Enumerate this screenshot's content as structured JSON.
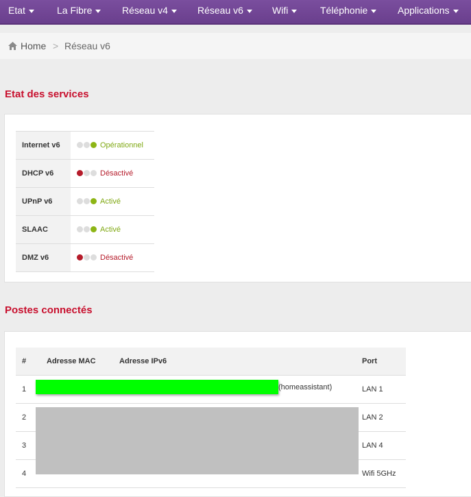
{
  "nav": {
    "items": [
      {
        "label": "Etat"
      },
      {
        "label": "La Fibre"
      },
      {
        "label": "Réseau v4"
      },
      {
        "label": "Réseau v6"
      },
      {
        "label": "Wifi"
      },
      {
        "label": "Téléphonie"
      },
      {
        "label": "Applications"
      }
    ]
  },
  "breadcrumb": {
    "home": "Home",
    "separator": ">",
    "current": "Réseau v6"
  },
  "services": {
    "title": "Etat des services",
    "rows": [
      {
        "name": "Internet v6",
        "status": "Opérationnel",
        "state": "on"
      },
      {
        "name": "DHCP v6",
        "status": "Désactivé",
        "state": "off"
      },
      {
        "name": "UPnP v6",
        "status": "Activé",
        "state": "on"
      },
      {
        "name": "SLAAC",
        "status": "Activé",
        "state": "on"
      },
      {
        "name": "DMZ v6",
        "status": "Désactivé",
        "state": "off"
      }
    ]
  },
  "hosts": {
    "title": "Postes connectés",
    "columns": {
      "num": "#",
      "mac": "Adresse MAC",
      "ipv6": "Adresse IPv6",
      "port": "Port"
    },
    "rows": [
      {
        "num": "1",
        "hostname": "(homeassistant)",
        "port": "LAN 1"
      },
      {
        "num": "2",
        "port": "LAN 2"
      },
      {
        "num": "3",
        "port": "LAN 4"
      },
      {
        "num": "4",
        "port": "Wifi 5GHz"
      }
    ]
  },
  "colors": {
    "nav": "#6a3f8d",
    "accent_red": "#c8102e",
    "ok_green": "#8db515",
    "redaction_green": "#00ff00",
    "redaction_gray": "#c0c0c0"
  }
}
